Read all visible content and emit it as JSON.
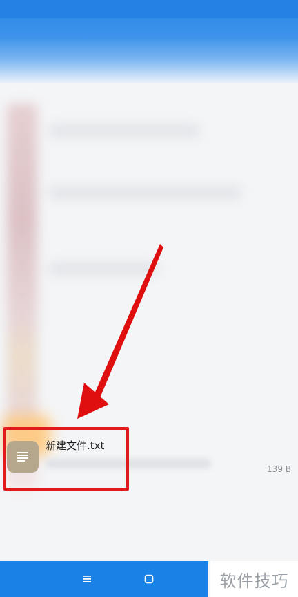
{
  "file": {
    "name": "新建文件.txt",
    "size": "139 B",
    "icon": "text-file-icon"
  },
  "navigation": {
    "menu_icon": "menu-icon",
    "home_icon": "home-icon"
  },
  "watermark": {
    "text": "软件技巧"
  },
  "colors": {
    "header": "#2b87e6",
    "nav": "#1a82e6",
    "highlight": "#e11b1b",
    "file_icon_bg": "#b4a78c"
  }
}
